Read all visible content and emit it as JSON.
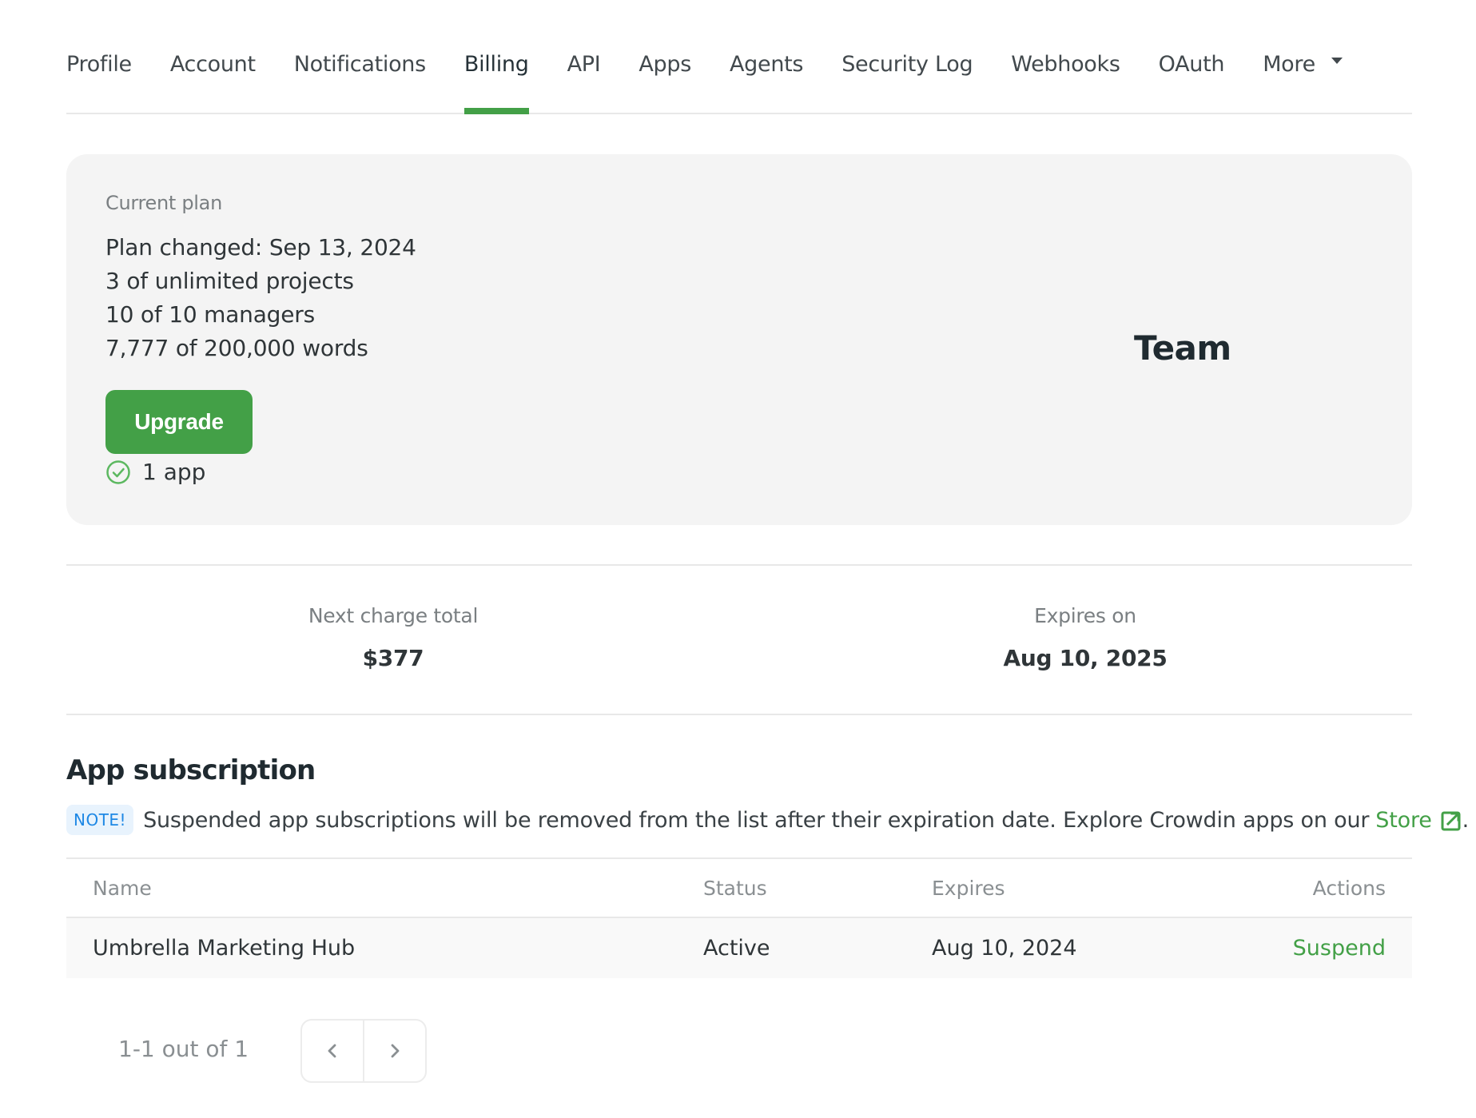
{
  "tabs": [
    {
      "label": "Profile",
      "active": false
    },
    {
      "label": "Account",
      "active": false
    },
    {
      "label": "Notifications",
      "active": false
    },
    {
      "label": "Billing",
      "active": true
    },
    {
      "label": "API",
      "active": false
    },
    {
      "label": "Apps",
      "active": false
    },
    {
      "label": "Agents",
      "active": false
    },
    {
      "label": "Security Log",
      "active": false
    },
    {
      "label": "Webhooks",
      "active": false
    },
    {
      "label": "OAuth",
      "active": false
    },
    {
      "label": "More",
      "active": false,
      "has_dropdown": true,
      "icon": "caret-down-icon"
    }
  ],
  "plan": {
    "label": "Current plan",
    "lines": [
      "Plan changed: Sep 13, 2024",
      "3 of unlimited projects",
      "10 of 10 managers",
      "7,777 of 200,000 words"
    ],
    "upgrade_label": "Upgrade",
    "app_count": "1 app",
    "app_count_icon": "check-circle-icon",
    "plan_name": "Team"
  },
  "stats": {
    "next_charge_label": "Next charge total",
    "next_charge_value": "$377",
    "expires_label": "Expires on",
    "expires_value": "Aug 10, 2025"
  },
  "app_subscription": {
    "title": "App subscription",
    "note_badge": "NOTE!",
    "note_text": "Suspended app subscriptions will be removed from the list after their expiration date. Explore Crowdin apps on our",
    "store_link": "Store",
    "note_end": ".",
    "columns": {
      "name": "Name",
      "status": "Status",
      "expires": "Expires",
      "actions": "Actions"
    },
    "rows": [
      {
        "name": "Umbrella Marketing Hub",
        "status": "Active",
        "expires": "Aug 10, 2024",
        "action": "Suspend"
      }
    ]
  },
  "pagination": {
    "text": "1-1 out of 1"
  },
  "colors": {
    "accent": "#43a047",
    "note_badge_bg": "#e8f3fd",
    "note_badge_text": "#1e88e5"
  }
}
